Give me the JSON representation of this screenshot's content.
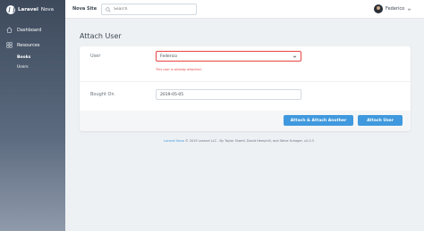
{
  "brand": {
    "name": "Laravel",
    "suffix": "Nova"
  },
  "sidebar": {
    "items": [
      {
        "label": "Dashboard",
        "icon": "home-icon"
      },
      {
        "label": "Resources",
        "icon": "grid-icon"
      }
    ],
    "sub_items": [
      {
        "label": "Books",
        "active": true
      },
      {
        "label": "Users",
        "active": false
      }
    ]
  },
  "header": {
    "site_name": "Nova Site",
    "search_placeholder": "Search",
    "user_name": "Federico"
  },
  "page": {
    "title": "Attach User"
  },
  "form": {
    "user_label": "User",
    "user_value": "Federico",
    "user_error": "This user is already attached.",
    "bought_label": "Bought On",
    "bought_value": "2019-05-05"
  },
  "buttons": {
    "attach_another": "Attach & Attach Another",
    "attach": "Attach User"
  },
  "footer": {
    "link": "Laravel Nova",
    "text": "© 2019 Laravel LLC - By Taylor Otwell, David Hemphill, and Steve Schoger.",
    "version": "v2.0.3"
  },
  "colors": {
    "accent": "#4099de",
    "danger": "#e74444",
    "sidebar": "#3d4a5c"
  }
}
